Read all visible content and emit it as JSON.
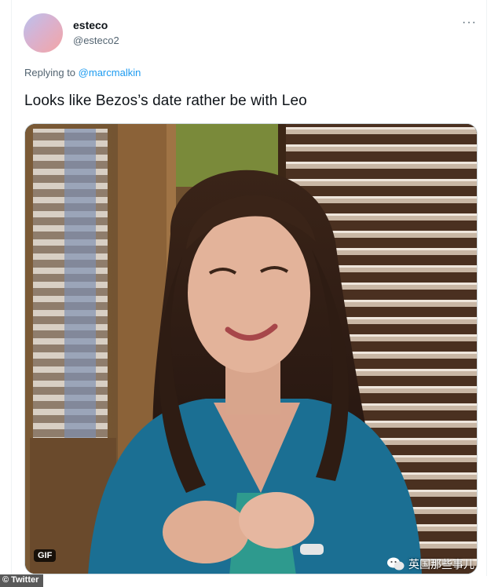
{
  "tweet": {
    "display_name": "esteco",
    "handle": "@esteco2",
    "more_icon": "···",
    "replying_prefix": "Replying to",
    "replying_to": "@marcmalkin",
    "text": "Looks like Bezos’s date rather be with Leo"
  },
  "media": {
    "badge": "GIF"
  },
  "source_label": "Twitter",
  "watermark_text": "英国那些事儿"
}
